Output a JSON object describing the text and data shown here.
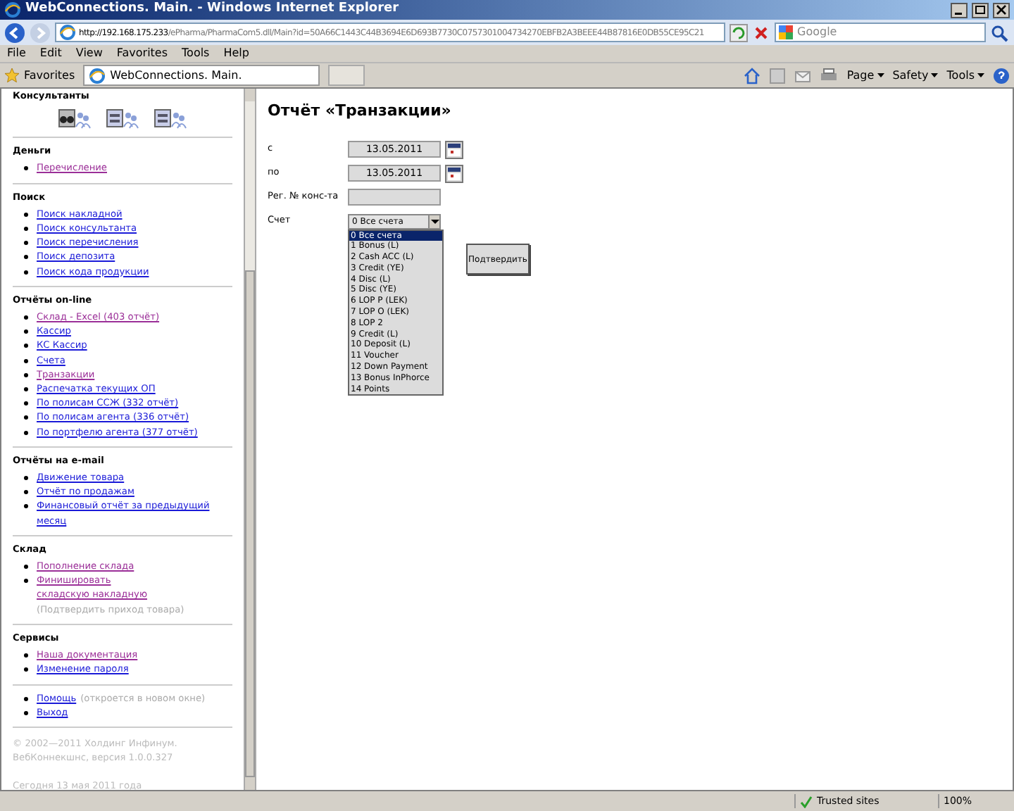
{
  "window": {
    "title": "WebConnections. Main. - Windows Internet Explorer"
  },
  "address_bar": {
    "host": "http://192.168.175.233",
    "path": "/ePharma/PharmaCom5.dll/Main?id=50A66C1443C44B3694E6D693B7730C0757301004734270EBFB2A3BEEE44B87816E0DB55CE95C21"
  },
  "search": {
    "placeholder": "Google"
  },
  "menu": [
    "File",
    "Edit",
    "View",
    "Favorites",
    "Tools",
    "Help"
  ],
  "favorites": {
    "label": "Favorites",
    "tab": "WebConnections. Main."
  },
  "command_bar": [
    "Page",
    "Safety",
    "Tools"
  ],
  "sidebar": {
    "icons_title": "Консультанты",
    "sections": [
      {
        "title": "Деньги",
        "items": [
          {
            "label": "Перечисление",
            "visited": true
          }
        ]
      },
      {
        "title": "Поиск",
        "items": [
          {
            "label": "Поиск накладной",
            "visited": false
          },
          {
            "label": "Поиск консультанта",
            "visited": false
          },
          {
            "label": "Поиск перечисления",
            "visited": false
          },
          {
            "label": "Поиск депозита",
            "visited": false
          },
          {
            "label": "Поиск кода продукции",
            "visited": false
          }
        ]
      },
      {
        "title": "Отчёты on-line",
        "items": [
          {
            "label": "Склад - Excel (403 отчёт)",
            "visited": true
          },
          {
            "label": "Кассир",
            "visited": false
          },
          {
            "label": "КС Кассир",
            "visited": false
          },
          {
            "label": "Счета",
            "visited": false
          },
          {
            "label": "Транзакции",
            "visited": true
          },
          {
            "label": "Распечатка текущих ОП",
            "visited": false
          },
          {
            "label": "По полисам ССЖ (332 отчёт)",
            "visited": false
          },
          {
            "label": "По полисам агента (336 отчёт)",
            "visited": false
          },
          {
            "label": "По портфелю агента (377 отчёт)",
            "visited": false
          }
        ]
      },
      {
        "title": "Отчёты на e-mail",
        "items": [
          {
            "label": "Движение товара",
            "visited": false
          },
          {
            "label": "Отчёт по продажам",
            "visited": false
          },
          {
            "label": "Финансовый отчёт за предыдущий месяц",
            "visited": false
          }
        ]
      },
      {
        "title": "Склад",
        "items": [
          {
            "label": "Пополнение склада",
            "visited": true
          },
          {
            "label": "Финишировать складскую накладную",
            "visited": true,
            "note": "(Подтвердить приход товара)"
          }
        ]
      },
      {
        "title": "Сервисы",
        "items": [
          {
            "label": "Наша документация",
            "visited": true
          },
          {
            "label": "Изменение пароля",
            "visited": false
          }
        ]
      },
      {
        "items": [
          {
            "label": "Помощь",
            "visited": false,
            "note": "(откроется в новом окне)"
          },
          {
            "label": "Выход",
            "visited": false
          }
        ]
      }
    ],
    "copyright": "© 2002—2011 Холдинг Инфинум. ВебКоннекшнс, версия 1.0.0.327",
    "date": "Сегодня 13 мая 2011 года"
  },
  "report": {
    "title": "Отчёт «Транзакции»",
    "fields": [
      {
        "kind": "date",
        "label": "с",
        "value": "13.05.2011"
      },
      {
        "kind": "date",
        "label": "по",
        "value": "13.05.2011"
      },
      {
        "kind": "text",
        "label": "Рег. № конс-та"
      },
      {
        "kind": "select",
        "label": "Счет",
        "value": "0 Все счета"
      }
    ],
    "options": [
      {
        "label": "0 Все счета",
        "selected": true
      },
      {
        "label": "1 Bonus (L)",
        "selected": false
      },
      {
        "label": "2 Cash ACC (L)",
        "selected": false
      },
      {
        "label": "3 Credit (YE)",
        "selected": false
      },
      {
        "label": "4 Disc (L)",
        "selected": false
      },
      {
        "label": "5 Disc (YE)",
        "selected": false
      },
      {
        "label": "6 LOP P (LEK)",
        "selected": false
      },
      {
        "label": "7 LOP O (LEK)",
        "selected": false
      },
      {
        "label": "8 LOP 2",
        "selected": false
      },
      {
        "label": "9 Credit (L)",
        "selected": false
      },
      {
        "label": "10 Deposit (L)",
        "selected": false
      },
      {
        "label": "11 Voucher",
        "selected": false
      },
      {
        "label": "12 Down Payment",
        "selected": false
      },
      {
        "label": "13 Bonus InPhorce",
        "selected": false
      },
      {
        "label": "14 Points",
        "selected": false
      }
    ],
    "submit": "Подтвердить"
  },
  "status_bar": {
    "zone": "Trusted sites",
    "zoom": "100%"
  }
}
